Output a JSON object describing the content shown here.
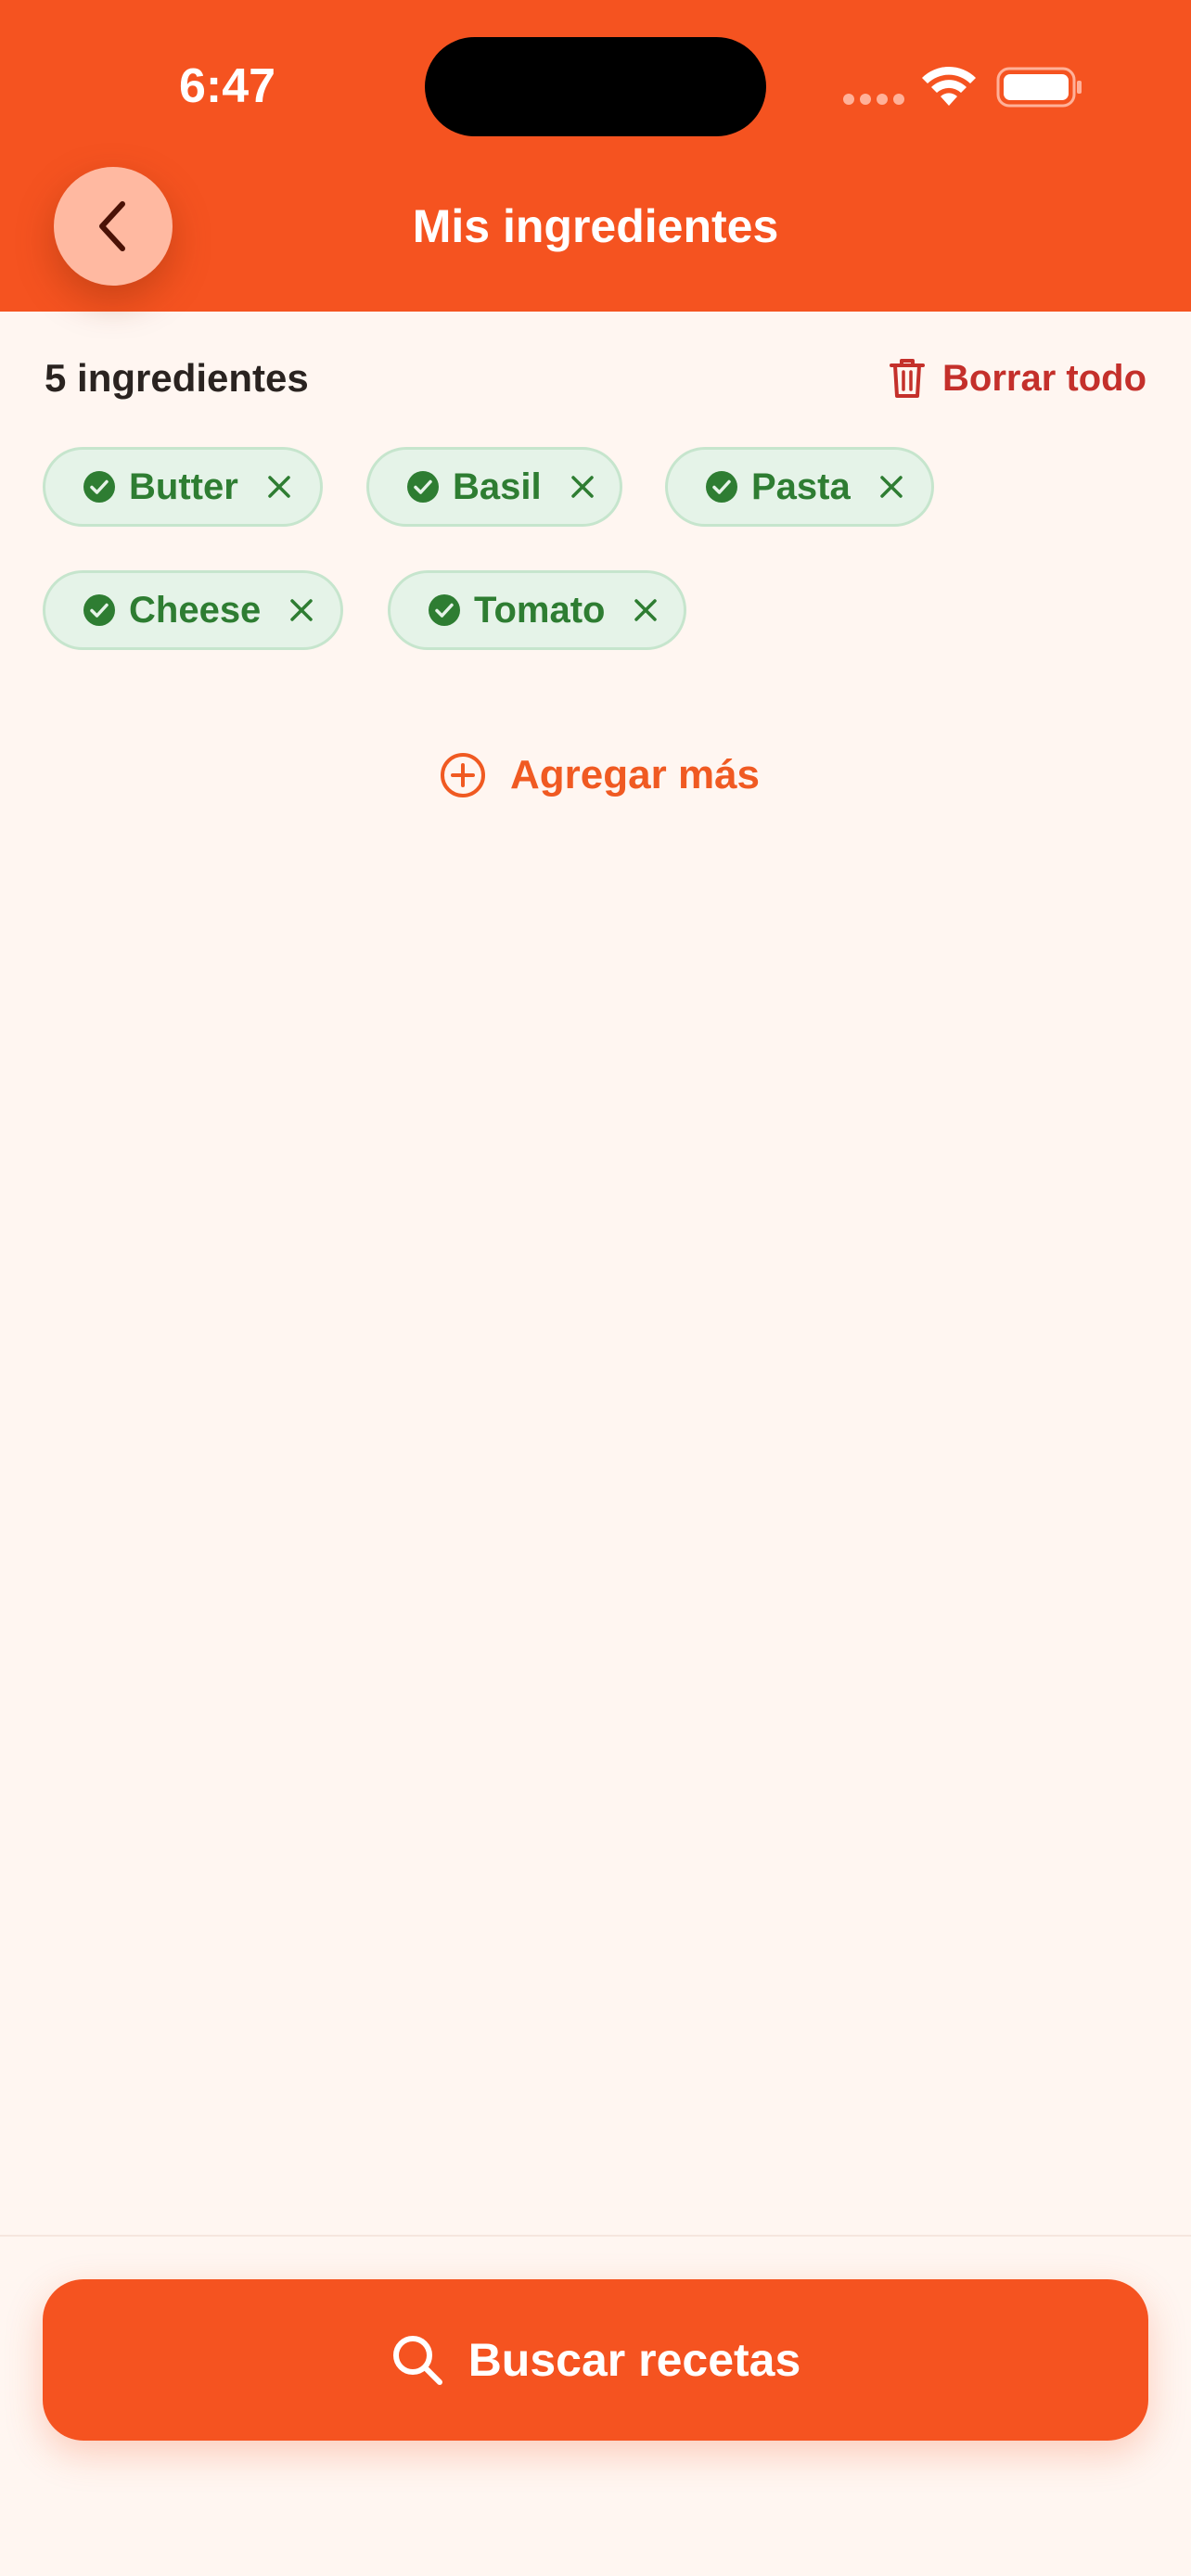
{
  "status_bar": {
    "time": "6:47"
  },
  "header": {
    "title": "Mis ingredientes"
  },
  "toolbar": {
    "count_label": "5 ingredientes",
    "clear_all_label": "Borrar todo"
  },
  "ingredients": [
    {
      "label": "Butter"
    },
    {
      "label": "Basil"
    },
    {
      "label": "Pasta"
    },
    {
      "label": "Cheese"
    },
    {
      "label": "Tomato"
    }
  ],
  "add_more_label": "Agregar más",
  "search_button_label": "Buscar recetas",
  "colors": {
    "brand": "#F55320",
    "background": "#FFF6F1",
    "chip_bg": "#E5F3E8",
    "chip_text": "#2E7D32",
    "danger": "#C4302B"
  },
  "icons": [
    "back-chevron-icon",
    "trash-icon",
    "check-circle-icon",
    "close-icon",
    "plus-circle-icon",
    "search-icon",
    "wifi-icon",
    "battery-icon",
    "signal-icon"
  ]
}
